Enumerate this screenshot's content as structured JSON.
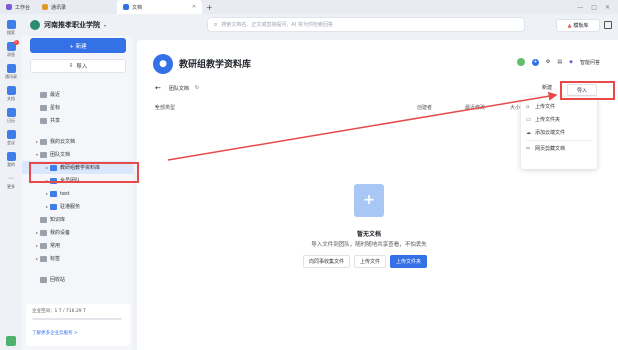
{
  "topbar": {
    "tabs": [
      {
        "label": "工作台",
        "color": "#7b5cd6",
        "active": false
      },
      {
        "label": "通讯录",
        "color": "#e09a2a",
        "active": false
      },
      {
        "label": "文档",
        "color": "#3471e6",
        "active": true
      }
    ],
    "plus": "+",
    "window_controls": [
      "—",
      "□",
      "✕"
    ]
  },
  "rail": {
    "items": [
      {
        "label": "搜索",
        "icon": "search-icon"
      },
      {
        "label": "消息",
        "icon": "message-icon",
        "badge": "1"
      },
      {
        "label": "通讯录",
        "icon": "contacts-icon"
      },
      {
        "label": "文档",
        "icon": "doc-icon"
      },
      {
        "label": "日历",
        "icon": "calendar-icon"
      },
      {
        "label": "会议",
        "icon": "meeting-icon"
      },
      {
        "label": "我的",
        "icon": "user-icon"
      },
      {
        "label": "更多",
        "icon": "more-icon"
      }
    ]
  },
  "workspace": {
    "name": "河南推孝职业学院"
  },
  "search": {
    "placeholder": "搜索文档名、正文或直接提问，AI 将为你检索回答"
  },
  "header": {
    "template_label": "模板库"
  },
  "sidebar": {
    "new_label": "+ 新建",
    "import_label": "导入",
    "nav": [
      {
        "label": "最近",
        "icon": "clock-icon",
        "indent": 0,
        "arrow": ""
      },
      {
        "label": "星标",
        "icon": "star-icon",
        "indent": 0,
        "arrow": ""
      },
      {
        "label": "共享",
        "icon": "share-icon",
        "indent": 0,
        "arrow": ""
      },
      {
        "label": "",
        "icon": "",
        "indent": 0,
        "arrow": "",
        "spacer": true
      },
      {
        "label": "我的云文档",
        "icon": "cloud-doc-icon",
        "indent": 0,
        "arrow": "▸"
      },
      {
        "label": "团队文档",
        "icon": "team-doc-icon",
        "indent": 0,
        "arrow": "▾"
      },
      {
        "label": "教研组教学资料库",
        "icon": "folder-icon",
        "indent": 1,
        "arrow": "▸",
        "selected": true
      },
      {
        "label": "全员团队",
        "icon": "folder-icon",
        "indent": 1,
        "arrow": "▸"
      },
      {
        "label": "test",
        "icon": "folder-icon",
        "indent": 1,
        "arrow": "▸"
      },
      {
        "label": "驻港服务",
        "icon": "folder-icon",
        "indent": 1,
        "arrow": "▸"
      },
      {
        "label": "知识库",
        "icon": "knowledge-icon",
        "indent": 0,
        "arrow": ""
      },
      {
        "label": "我的设备",
        "icon": "device-icon",
        "indent": 0,
        "arrow": "▸"
      },
      {
        "label": "常用",
        "icon": "bookmark-icon",
        "indent": 0,
        "arrow": "▸"
      },
      {
        "label": "标签",
        "icon": "tag-icon",
        "indent": 0,
        "arrow": "▸"
      },
      {
        "label": "",
        "icon": "",
        "indent": 0,
        "arrow": "",
        "spacer": true
      },
      {
        "label": "回收站",
        "icon": "trash-icon",
        "indent": 0,
        "arrow": ""
      }
    ],
    "storage_text": "企业空间：1 T / 716.29 T",
    "storage_fraction": 0.001,
    "upgrade_link": "了解更多企业云服务 >"
  },
  "main": {
    "title": "教研组教学资料库",
    "ai_label": "智能问答",
    "breadcrumb": "团队文档",
    "new_label": "新建",
    "import_label": "导入",
    "columns": [
      "全部类型",
      "创建者",
      "最近修改",
      "大小"
    ],
    "empty_title": "暂无文档",
    "empty_subtitle": "导入文件到团队，随时随地共享查看，不怕丢失",
    "empty_actions": [
      "向同事收集文件",
      "上传文件",
      "上传文件夹"
    ]
  },
  "menu": {
    "items": [
      {
        "label": "上传文件",
        "icon": "upload-file-icon"
      },
      {
        "label": "上传文件夹",
        "icon": "upload-folder-icon"
      },
      {
        "label": "添加云端文件",
        "icon": "cloud-add-icon"
      },
      {
        "label": "网页剪藏文档",
        "icon": "scissors-icon"
      }
    ]
  },
  "colors": {
    "accent": "#3471e6",
    "annotation": "#e84a4a"
  }
}
